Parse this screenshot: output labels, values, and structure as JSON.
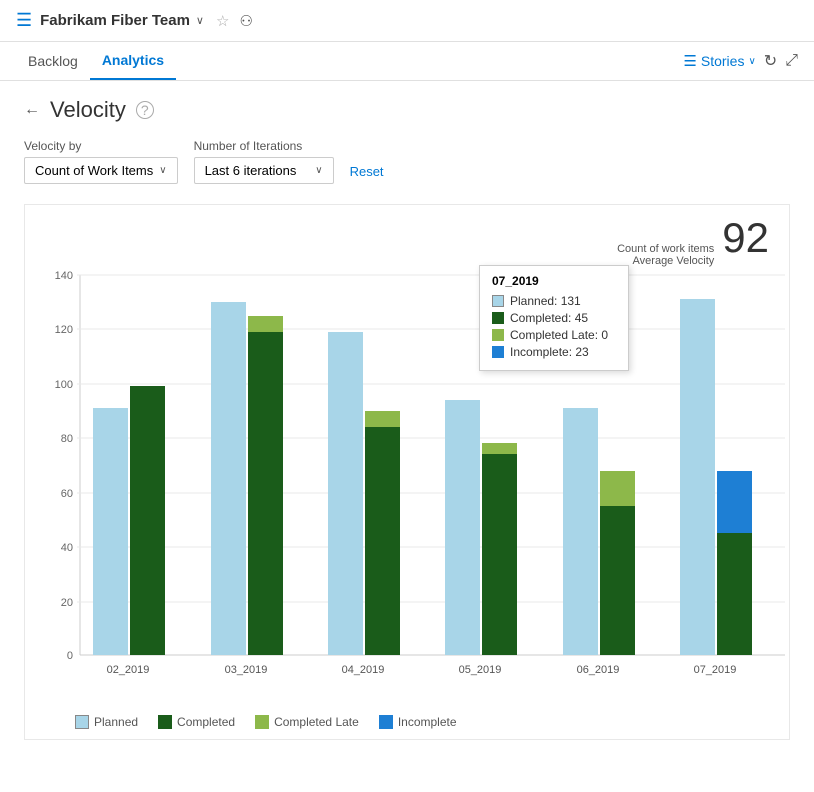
{
  "header": {
    "icon": "☰",
    "team_name": "Fabrikam Fiber Team",
    "chevron": "∨",
    "star": "☆",
    "people": "⚇"
  },
  "nav": {
    "tabs": [
      {
        "label": "Backlog",
        "active": false
      },
      {
        "label": "Analytics",
        "active": true
      }
    ],
    "stories_label": "Stories",
    "refresh_icon": "↻",
    "expand_icon": "⤢"
  },
  "page": {
    "back_arrow": "←",
    "title": "Velocity",
    "help": "?"
  },
  "filters": {
    "velocity_by_label": "Velocity by",
    "velocity_by_value": "Count of Work Items",
    "iterations_label": "Number of Iterations",
    "iterations_value": "Last 6 iterations",
    "reset_label": "Reset"
  },
  "velocity_summary": {
    "line1": "Count of work items",
    "line2": "Average Velocity",
    "value": "92"
  },
  "tooltip": {
    "title": "07_2019",
    "rows": [
      {
        "color": "#add8e6",
        "label": "Planned: 131"
      },
      {
        "color": "#006400",
        "label": "Completed: 45"
      },
      {
        "color": "#9acd32",
        "label": "Completed Late: 0"
      },
      {
        "color": "#1e90ff",
        "label": "Incomplete: 23"
      }
    ]
  },
  "chart": {
    "bars": [
      {
        "label": "02_2019",
        "planned": 91,
        "completed": 99,
        "completed_late": 0,
        "incomplete": 0
      },
      {
        "label": "03_2019",
        "planned": 130,
        "completed": 119,
        "completed_late": 6,
        "incomplete": 0
      },
      {
        "label": "04_2019",
        "planned": 119,
        "completed": 84,
        "completed_late": 6,
        "incomplete": 0
      },
      {
        "label": "05_2019",
        "planned": 94,
        "completed": 74,
        "completed_late": 4,
        "incomplete": 0
      },
      {
        "label": "06_2019",
        "planned": 91,
        "completed": 55,
        "completed_late": 13,
        "incomplete": 0
      },
      {
        "label": "07_2019",
        "planned": 131,
        "completed": 45,
        "completed_late": 0,
        "incomplete": 23
      }
    ],
    "y_max": 140,
    "y_ticks": [
      0,
      20,
      40,
      60,
      80,
      100,
      120,
      140
    ],
    "colors": {
      "planned": "#a8d5e8",
      "completed": "#1a5c1a",
      "completed_late": "#8db84a",
      "incomplete": "#1e7fd4"
    }
  },
  "legend": {
    "items": [
      {
        "color": "#a8d5e8",
        "label": "Planned"
      },
      {
        "color": "#1a5c1a",
        "label": "Completed"
      },
      {
        "color": "#8db84a",
        "label": "Completed Late"
      },
      {
        "color": "#1e7fd4",
        "label": "Incomplete"
      }
    ]
  }
}
